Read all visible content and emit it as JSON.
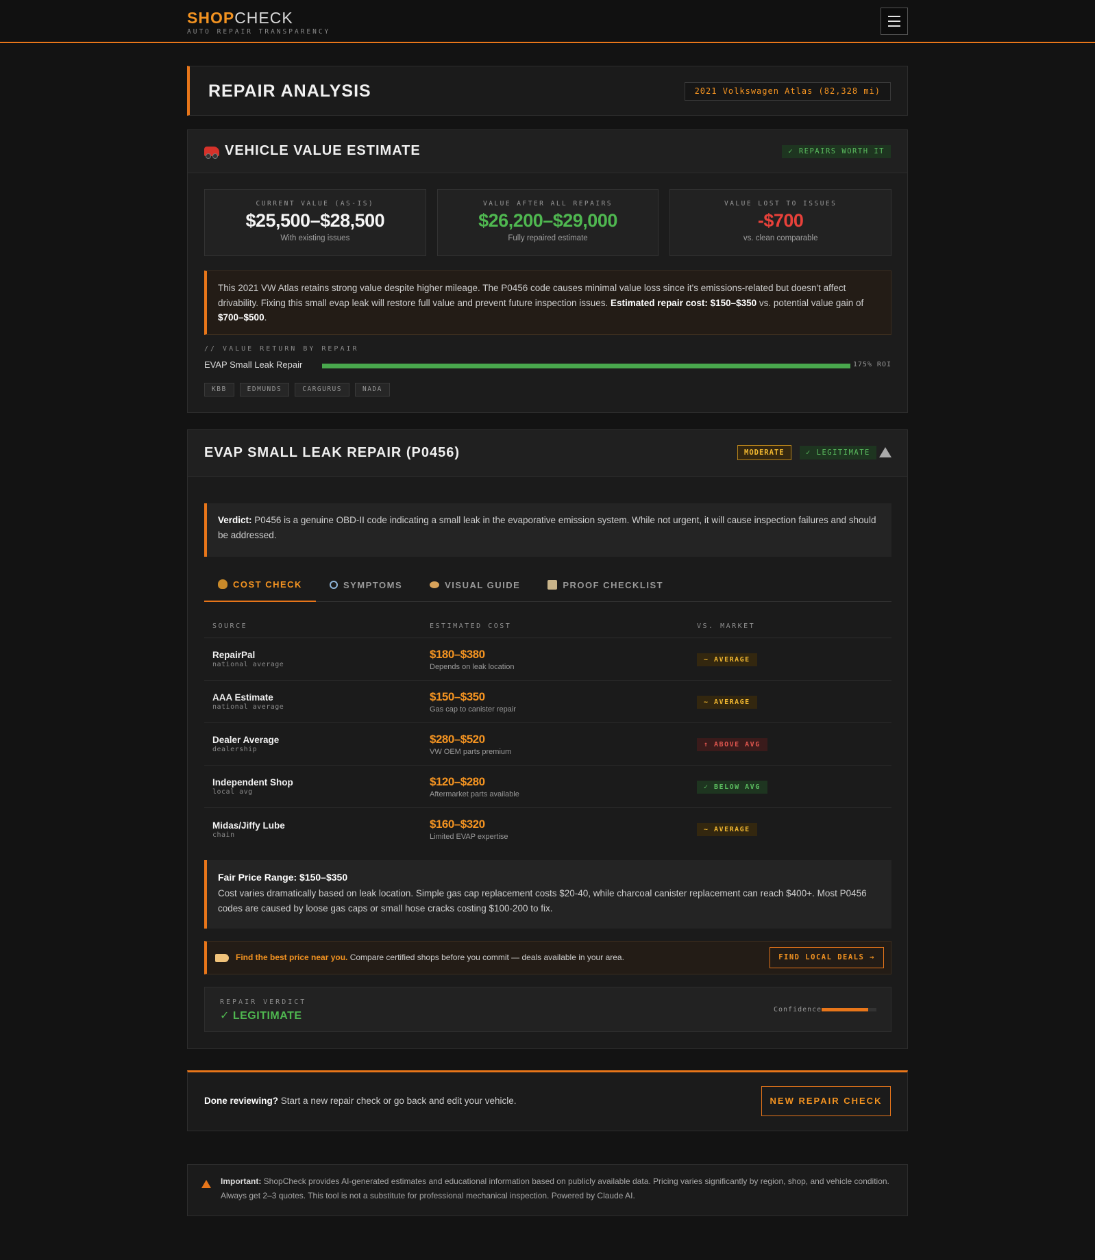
{
  "header": {
    "logo_shop": "SHOP",
    "logo_check": "CHECK",
    "tagline": "AUTO REPAIR TRANSPARENCY"
  },
  "analysis": {
    "title": "REPAIR ANALYSIS",
    "vehicle": "2021 Volkswagen Atlas (82,328 mi)"
  },
  "value_estimate": {
    "title": "VEHICLE VALUE ESTIMATE",
    "badge": "✓ REPAIRS WORTH IT",
    "cards": [
      {
        "label": "CURRENT VALUE (AS-IS)",
        "value": "$25,500–$28,500",
        "sub": "With existing issues",
        "color": "#f5f5f5"
      },
      {
        "label": "VALUE AFTER ALL REPAIRS",
        "value": "$26,200–$29,000",
        "sub": "Fully repaired estimate",
        "color": "#4fb750"
      },
      {
        "label": "VALUE LOST TO ISSUES",
        "value": "-$700",
        "sub": "vs. clean comparable",
        "color": "#e8413a"
      }
    ],
    "note_text": "This 2021 VW Atlas retains strong value despite higher mileage. The P0456 code causes minimal value loss since it's emissions-related but doesn't affect drivability. Fixing this small evap leak will restore full value and prevent future inspection issues.",
    "note_bold1": "Estimated repair cost: $150–$350",
    "note_mid": "vs. potential value gain of",
    "note_bold2": "$700–$500",
    "return_label": "// VALUE RETURN BY REPAIR",
    "return_rows": [
      {
        "name": "EVAP Small Leak Repair",
        "fill": 1.0,
        "roi": "175% ROI"
      }
    ],
    "sources": [
      "KBB",
      "EDMUNDS",
      "CARGURUS",
      "NADA"
    ]
  },
  "repair": {
    "title": "EVAP SMALL LEAK REPAIR (P0456)",
    "severity": "MODERATE",
    "legit": "✓ LEGITIMATE",
    "verdict_label": "Verdict:",
    "verdict_text": "P0456 is a genuine OBD-II code indicating a small leak in the evaporative emission system. While not urgent, it will cause inspection failures and should be addressed.",
    "tabs": [
      {
        "label": "COST CHECK",
        "icon": "money-bag-icon"
      },
      {
        "label": "SYMPTOMS",
        "icon": "magnifier-icon"
      },
      {
        "label": "VISUAL GUIDE",
        "icon": "eye-icon"
      },
      {
        "label": "PROOF CHECKLIST",
        "icon": "clipboard-icon"
      }
    ],
    "table_headers": [
      "SOURCE",
      "ESTIMATED COST",
      "VS. MARKET"
    ],
    "rows": [
      {
        "source": "RepairPal",
        "type": "national average",
        "cost": "$180–$380",
        "note": "Depends on leak location",
        "market": "~ AVERAGE",
        "kind": "avg"
      },
      {
        "source": "AAA Estimate",
        "type": "national average",
        "cost": "$150–$350",
        "note": "Gas cap to canister repair",
        "market": "~ AVERAGE",
        "kind": "avg"
      },
      {
        "source": "Dealer Average",
        "type": "dealership",
        "cost": "$280–$520",
        "note": "VW OEM parts premium",
        "market": "↑ ABOVE AVG",
        "kind": "above"
      },
      {
        "source": "Independent Shop",
        "type": "local avg",
        "cost": "$120–$280",
        "note": "Aftermarket parts available",
        "market": "✓ BELOW AVG",
        "kind": "below"
      },
      {
        "source": "Midas/Jiffy Lube",
        "type": "chain",
        "cost": "$160–$320",
        "note": "Limited EVAP expertise",
        "market": "~ AVERAGE",
        "kind": "avg"
      }
    ],
    "fair_title": "Fair Price Range: $150–$350",
    "fair_text": "Cost varies dramatically based on leak location. Simple gas cap replacement costs $20-40, while charcoal canister replacement can reach $400+. Most P0456 codes are caused by loose gas caps or small hose cracks costing $100-200 to fix.",
    "deals_bold": "Find the best price near you.",
    "deals_text": "Compare certified shops before you commit — deals available in your area.",
    "deals_button": "FIND LOCAL DEALS →",
    "rv_label": "REPAIR VERDICT",
    "rv_value": "✓ LEGITIMATE",
    "confidence_label": "Confidence",
    "confidence": 0.85
  },
  "done": {
    "bold": "Done reviewing?",
    "text": "Start a new repair check or go back and edit your vehicle.",
    "button": "NEW REPAIR CHECK"
  },
  "disclaimer": {
    "bold": "Important:",
    "text": "ShopCheck provides AI-generated estimates and educational information based on publicly available data. Pricing varies significantly by region, shop, and vehicle condition. Always get 2–3 quotes. This tool is not a substitute for professional mechanical inspection. Powered by Claude AI."
  }
}
